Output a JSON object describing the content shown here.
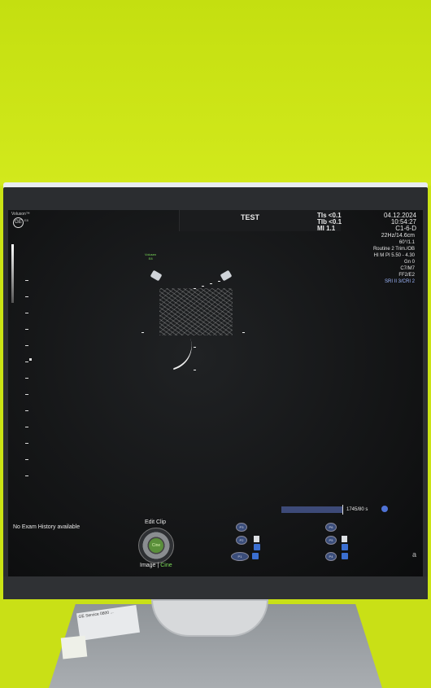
{
  "header": {
    "brand": "Voluson™",
    "logo_text": "GE",
    "logo_sub": "E8",
    "title": "TEST",
    "ti_s": "TIs <0.1",
    "ti_b": "TIb <0.1",
    "mi": "MI  1.1",
    "date": "04.12.2024",
    "time": "10:54:27",
    "probe": "C1-6-D"
  },
  "params": [
    "22Hz/14.6cm",
    "60°/1.1",
    "Routine 2 Trim./OB",
    "HI M PI 5.50 - 4.30",
    "Gn  0",
    "C7/M7",
    "FF2/E2",
    "SRI II 3/CRI 2"
  ],
  "image": {
    "volume_label_line1": "Volusen",
    "volume_label_line2": "E8"
  },
  "cine": {
    "count": "1745/80 s"
  },
  "footer": {
    "no_history": "No Exam History available",
    "edit_clip": "Edit Clip",
    "knob_label": "Cine",
    "image_label": "Image",
    "separator": "|",
    "cine_label": "Cine",
    "corner": "a"
  },
  "presets_left": [
    "P3",
    "P2",
    "P1"
  ],
  "presets_right": [
    "P6",
    "P5",
    "P4"
  ],
  "sticker_text": "GE Service 0800 ...",
  "colors": {
    "wall": "#cbe414",
    "screen": "#131415",
    "cine_bar": "#3d4a78",
    "accent_green": "#7cdc59",
    "accent_blue": "#4f73d6"
  }
}
